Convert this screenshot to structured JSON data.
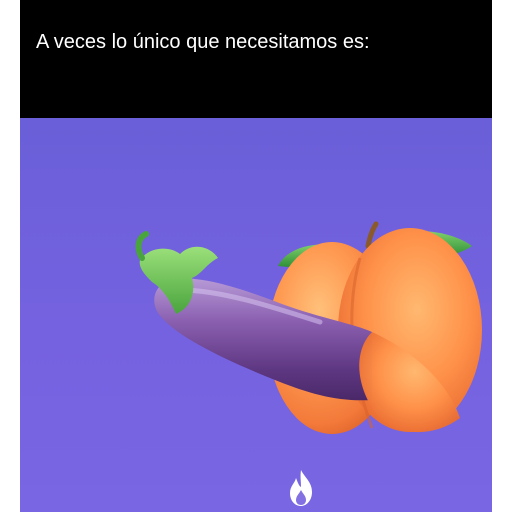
{
  "caption": {
    "text": "A veces lo único que necesitamos es:"
  },
  "scene": {
    "background_color": "#7562e0",
    "illustration": {
      "left_item_icon": "eggplant-icon",
      "right_item_icon": "peach-icon"
    },
    "watermark_icon": "flame-icon"
  }
}
